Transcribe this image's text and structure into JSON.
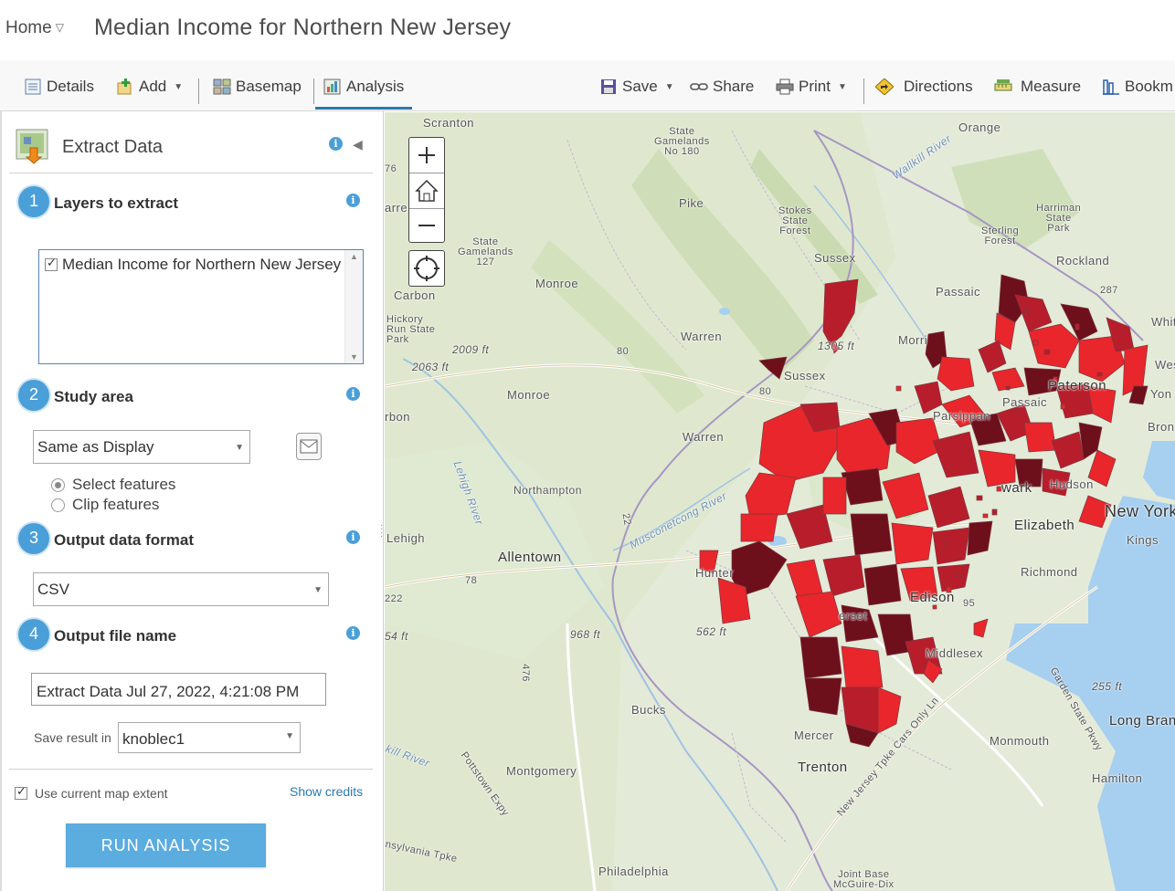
{
  "header": {
    "home_label": "Home",
    "map_title": "Median Income for Northern New Jersey"
  },
  "toolbar": {
    "details": "Details",
    "add": "Add",
    "basemap": "Basemap",
    "analysis": "Analysis",
    "save": "Save",
    "share": "Share",
    "print": "Print",
    "directions": "Directions",
    "measure": "Measure",
    "bookmarks": "Bookm"
  },
  "panel": {
    "title": "Extract Data",
    "step1": {
      "num": "1",
      "title": "Layers to extract",
      "layer": "Median Income for Northern New Jersey"
    },
    "step2": {
      "num": "2",
      "title": "Study area",
      "selected": "Same as Display",
      "option_select": "Select features",
      "option_clip": "Clip features"
    },
    "step3": {
      "num": "3",
      "title": "Output data format",
      "selected": "CSV"
    },
    "step4": {
      "num": "4",
      "title": "Output file name",
      "value": "Extract Data Jul 27, 2022, 4:21:08 PM",
      "save_in_label": "Save result in",
      "save_in_value": "knoblec1"
    },
    "use_extent_label": "Use current map extent",
    "show_credits": "Show credits",
    "run_button": "RUN ANALYSIS"
  },
  "map": {
    "labels": {
      "scranton": "Scranton",
      "state_gamelands_180": "State\nGamelands\nNo 180",
      "pike": "Pike",
      "stokes": "Stokes\nState\nForest",
      "sussex": "Sussex",
      "sussex2": "Sussex",
      "orange": "Orange",
      "wallkill": "Wallkill River",
      "harriman": "Harriman\nState\nPark",
      "sterling": "Sterling\nForest",
      "rockland": "Rockland",
      "rt287": "287",
      "white": "White",
      "gamelands_127": "State\nGamelands\n127",
      "monroe1": "Monroe",
      "carbon": "Carbon",
      "hickory": "Hickory\nRun State\nPark",
      "elev2009": "2009 ft",
      "elev2063": "2063 ft",
      "warren1": "Warren",
      "elev1305": "1305 ft",
      "morris": "Morri",
      "passaic1": "Passaic",
      "passaic2": "Passaic",
      "paterson": "Paterson",
      "parsippany": "Parsippan",
      "monroe2": "Monroe",
      "carbon2": "rbon",
      "warren2": "Warren",
      "northampton": "Northampton",
      "musconetcong": "Musconetcong River",
      "lehigh": "Lehigh",
      "lehigh_river": "Lehigh River",
      "allentown": "Allentown",
      "hunterdon": "Hunter",
      "newark": "wark",
      "hudson": "Hudson",
      "new_york": "New York",
      "elizabeth": "Elizabeth",
      "kings": "Kings",
      "richmond": "Richmond",
      "edison": "Edison",
      "somerset": "erset",
      "middlesex": "Middlesex",
      "elev968": "968 ft",
      "elev562": "562 ft",
      "elev54": "54 ft",
      "elev222": "222",
      "rt78": "78",
      "rt80": "80",
      "rt80b": "80",
      "rt476": "476",
      "rt22": "22",
      "rt95": "95",
      "bucks": "Bucks",
      "mercer": "Mercer",
      "trenton": "Trenton",
      "montgomery": "Montgomery",
      "pottstown": "Pottstown Expy",
      "kill_river": "kill River",
      "pennsylvania": "nsylvania Tpke",
      "philadelphia": "Philadelphia",
      "nj_turnpike": "New Jersey Tpke Cars Only Ln",
      "monmouth": "Monmouth",
      "garden_state": "Garden State Pkwy",
      "elev255": "255 ft",
      "long_branch": "Long Bran",
      "hamilton": "Hamilton",
      "joint_base": "Joint Base\nMcGuire-Dix",
      "yon": "Yon",
      "bron": "Bron",
      "wes": "Wes",
      "arre": "arre",
      "n76": "76"
    }
  },
  "colors": {
    "accent_blue": "#4a9fd8",
    "run_button": "#5bacdf",
    "income_low": "#e8262b",
    "income_mid": "#b81d2b",
    "income_high": "#6e0f1c",
    "water": "#a6cff0"
  },
  "icons": {
    "details": "details-icon",
    "add": "add-icon",
    "basemap": "basemap-icon",
    "analysis": "analysis-icon",
    "save": "save-icon",
    "share": "share-icon",
    "print": "print-icon",
    "directions": "directions-icon",
    "measure": "measure-icon",
    "bookmarks": "bookmarks-icon"
  }
}
